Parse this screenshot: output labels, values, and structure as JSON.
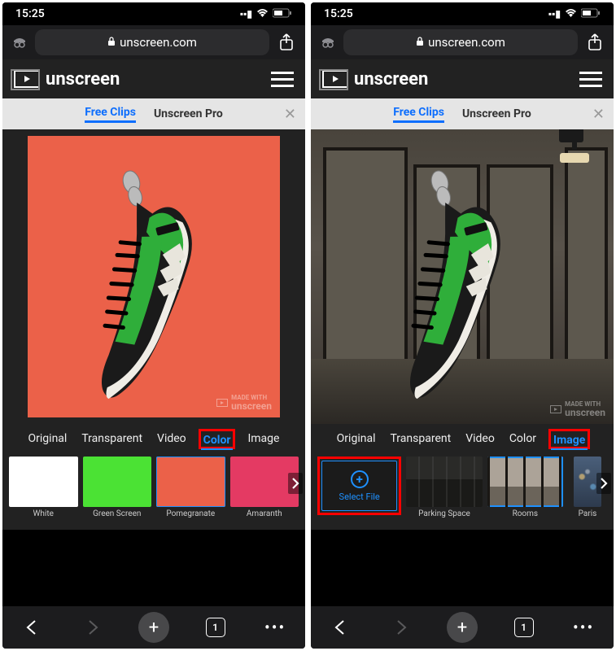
{
  "status": {
    "time": "15:25"
  },
  "browser": {
    "url": "unscreen.com",
    "tab_count": "1"
  },
  "header": {
    "brand": "unscreen"
  },
  "nav_tabs": {
    "free": "Free Clips",
    "pro": "Unscreen Pro"
  },
  "watermark": {
    "prefix": "MADE WITH",
    "brand": "unscreen"
  },
  "bg_tabs": [
    "Original",
    "Transparent",
    "Video",
    "Color",
    "Image"
  ],
  "left": {
    "active_bgtab": "Color",
    "swatches": [
      {
        "label": "White",
        "color": "#ffffff",
        "selected": false
      },
      {
        "label": "Green Screen",
        "color": "#4be234",
        "selected": false
      },
      {
        "label": "Pomegranate",
        "color": "#eb6149",
        "selected": true
      },
      {
        "label": "Amaranth",
        "color": "#e43a63",
        "selected": false
      }
    ]
  },
  "right": {
    "active_bgtab": "Image",
    "select_file_label": "Select File",
    "thumbs": [
      {
        "label": "Parking Space",
        "cls": "parking",
        "selected": false
      },
      {
        "label": "Rooms",
        "cls": "rooms",
        "selected": true
      },
      {
        "label": "Paris",
        "cls": "paris",
        "selected": false
      }
    ]
  }
}
